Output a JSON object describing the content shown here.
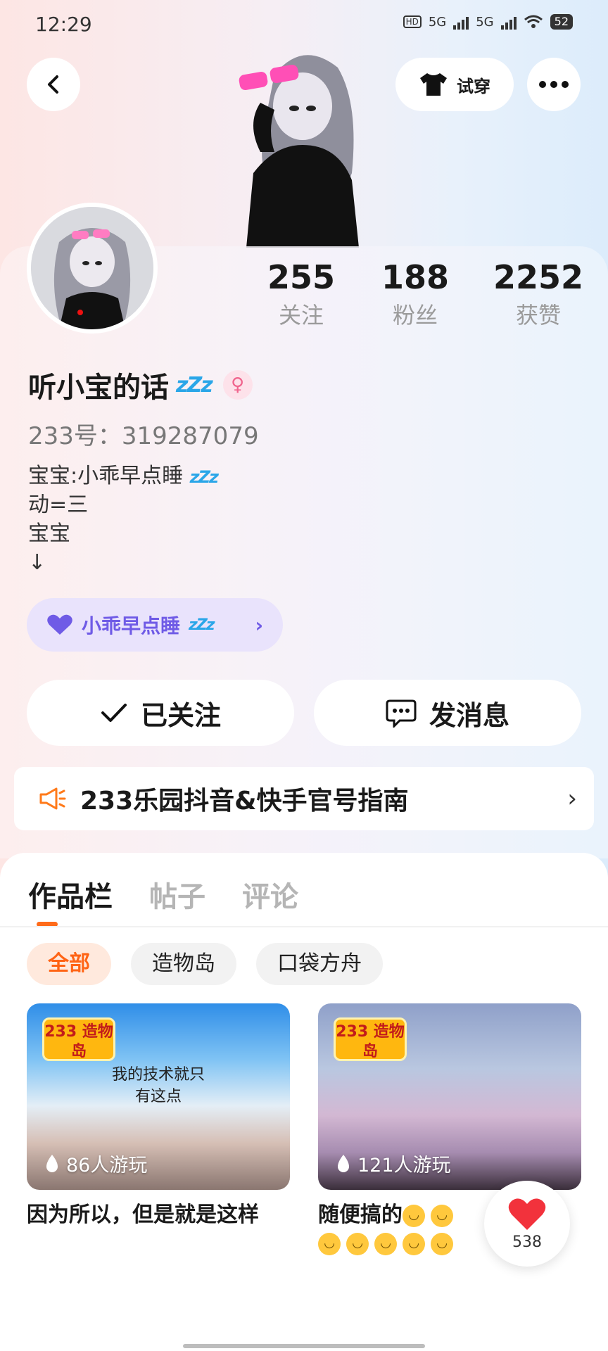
{
  "status_bar": {
    "time": "12:29",
    "network_1": "5G",
    "network_2": "5G",
    "battery": "52"
  },
  "header": {
    "try_on_label": "试穿"
  },
  "stats": [
    {
      "value": "255",
      "label": "关注"
    },
    {
      "value": "188",
      "label": "粉丝"
    },
    {
      "value": "2252",
      "label": "获赞"
    }
  ],
  "profile": {
    "name": "听小宝的话",
    "uid": "233号：319287079",
    "bio_lines": [
      "宝宝:小乖早点睡",
      "动=三",
      "宝宝",
      "↓"
    ],
    "tag_label": "小乖早点睡"
  },
  "actions": {
    "follow_label": "已关注",
    "message_label": "发消息"
  },
  "notice": {
    "text": "233乐园抖音&快手官号指南"
  },
  "tabs": [
    {
      "label": "作品栏",
      "active": true
    },
    {
      "label": "帖子",
      "active": false
    },
    {
      "label": "评论",
      "active": false
    }
  ],
  "filters": [
    {
      "label": "全部",
      "active": true
    },
    {
      "label": "造物岛",
      "active": false
    },
    {
      "label": "口袋方舟",
      "active": false
    }
  ],
  "works": [
    {
      "logo": "233 造物岛",
      "caption_lines": [
        "我的技术就只",
        "有这点"
      ],
      "plays": "86人游玩",
      "title": "因为所以，但是就是这样"
    },
    {
      "logo": "233 造物岛",
      "caption_lines": [],
      "plays": "121人游玩",
      "title": "随便搞的"
    }
  ],
  "like_float": {
    "count": "538"
  },
  "colors": {
    "accent_orange": "#ff6415",
    "tag_purple": "#6f5be6",
    "zzz_blue": "#2aa6e8"
  }
}
